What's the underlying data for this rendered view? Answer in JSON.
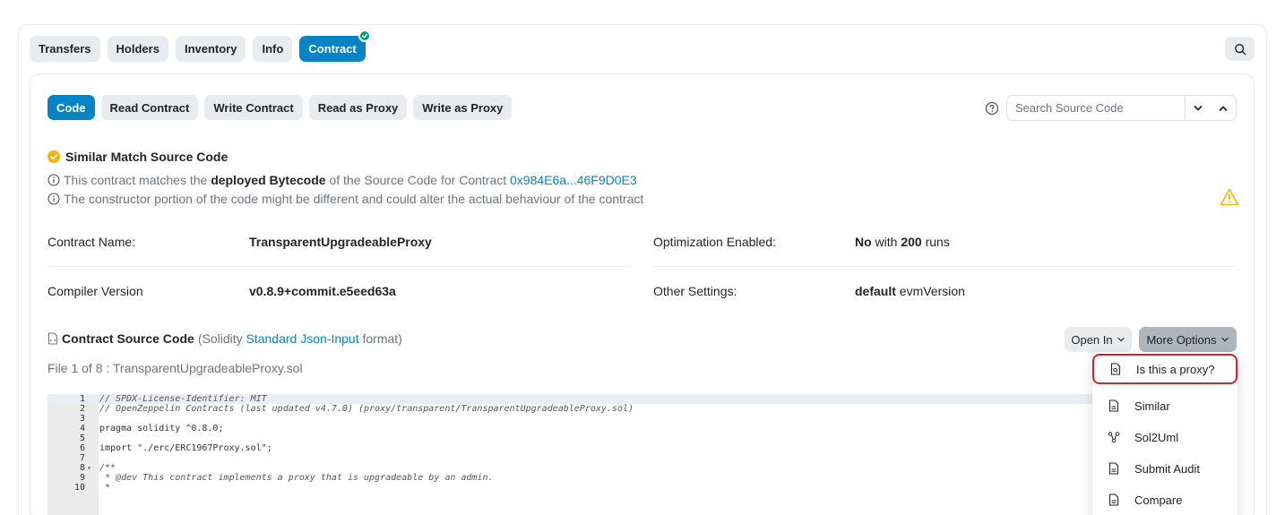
{
  "top_tabs": [
    {
      "label": "Transfers"
    },
    {
      "label": "Holders"
    },
    {
      "label": "Inventory"
    },
    {
      "label": "Info"
    },
    {
      "label": "Contract",
      "verified": true
    }
  ],
  "sub_tabs": [
    {
      "label": "Code"
    },
    {
      "label": "Read Contract"
    },
    {
      "label": "Write Contract"
    },
    {
      "label": "Read as Proxy"
    },
    {
      "label": "Write as Proxy"
    }
  ],
  "search": {
    "placeholder": "Search Source Code"
  },
  "match": {
    "title": "Similar Match Source Code",
    "line1_pre": "This contract matches the ",
    "line1_bold": "deployed Bytecode",
    "line1_mid": " of the Source Code for Contract ",
    "line1_link": "0x984E6a...46F9D0E3",
    "line2": "The constructor portion of the code might be different and could alter the actual behaviour of the contract"
  },
  "details": {
    "contract_name_label": "Contract Name:",
    "contract_name_value": "TransparentUpgradeableProxy",
    "optimization_label": "Optimization Enabled:",
    "optimization_value_bold": "No",
    "optimization_value_mid": " with ",
    "optimization_runs": "200",
    "optimization_value_suffix": " runs",
    "compiler_label": "Compiler Version",
    "compiler_value": "v0.8.9+commit.e5eed63a",
    "other_label": "Other Settings:",
    "other_value_bold": "default",
    "other_value_suffix": " evmVersion"
  },
  "source": {
    "title": "Contract Source Code",
    "paren_open": "(Solidity ",
    "format_link": "Standard Json-Input",
    "paren_close": " format)",
    "file_line": "File 1 of 8 : TransparentUpgradeableProxy.sol",
    "open_in_label": "Open In",
    "more_options_label": "More Options"
  },
  "code_lines": [
    {
      "n": "1",
      "t": "// SPDX-License-Identifier: MIT",
      "comment": true,
      "hl": true
    },
    {
      "n": "2",
      "t": "// OpenZeppelin Contracts (last updated v4.7.0) (proxy/transparent/TransparentUpgradeableProxy.sol)",
      "comment": true
    },
    {
      "n": "3",
      "t": ""
    },
    {
      "n": "4",
      "t": "pragma solidity ^0.8.0;"
    },
    {
      "n": "5",
      "t": ""
    },
    {
      "n": "6",
      "t": "import \"./erc/ERC1967Proxy.sol\";"
    },
    {
      "n": "7",
      "t": ""
    },
    {
      "n": "8",
      "t": "/**",
      "comment": true,
      "fold": true
    },
    {
      "n": "9",
      "t": " * @dev This contract implements a proxy that is upgradeable by an admin.",
      "comment": true
    },
    {
      "n": "10",
      "t": " *",
      "comment": true
    }
  ],
  "more_menu": [
    {
      "label": "Is this a proxy?",
      "icon": "file-search-icon",
      "highlighted": true
    },
    {
      "label": "Similar",
      "icon": "file-icon"
    },
    {
      "label": "Sol2Uml",
      "icon": "diagram-icon"
    },
    {
      "label": "Submit Audit",
      "icon": "file-icon"
    },
    {
      "label": "Compare",
      "icon": "file-icon"
    }
  ],
  "colors": {
    "primary": "#0784c3",
    "verified": "#00a186",
    "match": "#f4b400",
    "highlight_border": "#d0232a"
  }
}
